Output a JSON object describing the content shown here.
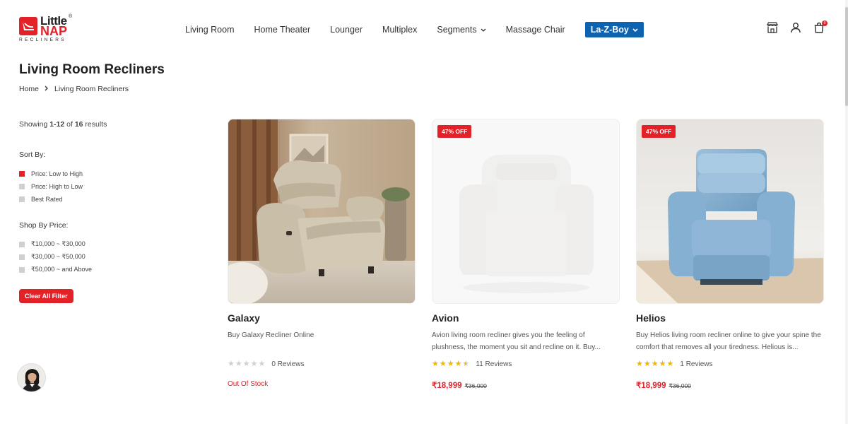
{
  "brand": {
    "little": "Little",
    "nap": "NAP",
    "reg": "®",
    "sub": "RECLINERS",
    "accent": "#e32129",
    "blue": "#0d63b0"
  },
  "nav": {
    "items": [
      "Living Room",
      "Home Theater",
      "Lounger",
      "Multiplex",
      "Segments",
      "Massage Chair"
    ],
    "highlight": "La-Z-Boy"
  },
  "header_icons": [
    "store-icon",
    "user-icon",
    "cart-icon"
  ],
  "cart_count": "0",
  "page": {
    "title": "Living Room Recliners",
    "breadcrumb": [
      "Home",
      "Living Room Recliners"
    ]
  },
  "sidebar": {
    "showing_prefix": "Showing ",
    "showing_range": "1-12",
    "showing_of": " of ",
    "showing_total": "16",
    "showing_suffix": " results",
    "sort_title": "Sort By:",
    "sort_options": [
      "Price: Low to High",
      "Price: High to Low",
      "Best Rated"
    ],
    "sort_selected": 0,
    "price_title": "Shop By Price:",
    "price_options": [
      "₹10,000 ~ ₹30,000",
      "₹30,000 ~ ₹50,000",
      "₹50,000 ~ and Above"
    ],
    "clear_label": "Clear All Filter"
  },
  "products": [
    {
      "name": "Galaxy",
      "desc": "Buy Galaxy Recliner Online",
      "rating": 0,
      "reviews": "0 Reviews",
      "stock": "Out Of Stock",
      "badge": "",
      "price": "",
      "old_price": ""
    },
    {
      "name": "Avion",
      "desc": "Avion living room recliner gives you the feeling of plushness, the moment you sit and recline on it. Buy...",
      "rating": 4.5,
      "reviews": "11 Reviews",
      "stock": "",
      "badge": "47% OFF",
      "price": "₹18,999",
      "old_price": "₹36,000"
    },
    {
      "name": "Helios",
      "desc": "Buy Helios living room recliner online to give your spine the comfort that removes all your tiredness. Helious is...",
      "rating": 5,
      "reviews": "1 Reviews",
      "stock": "",
      "badge": "47% OFF",
      "price": "₹18,999",
      "old_price": "₹36,000"
    }
  ]
}
